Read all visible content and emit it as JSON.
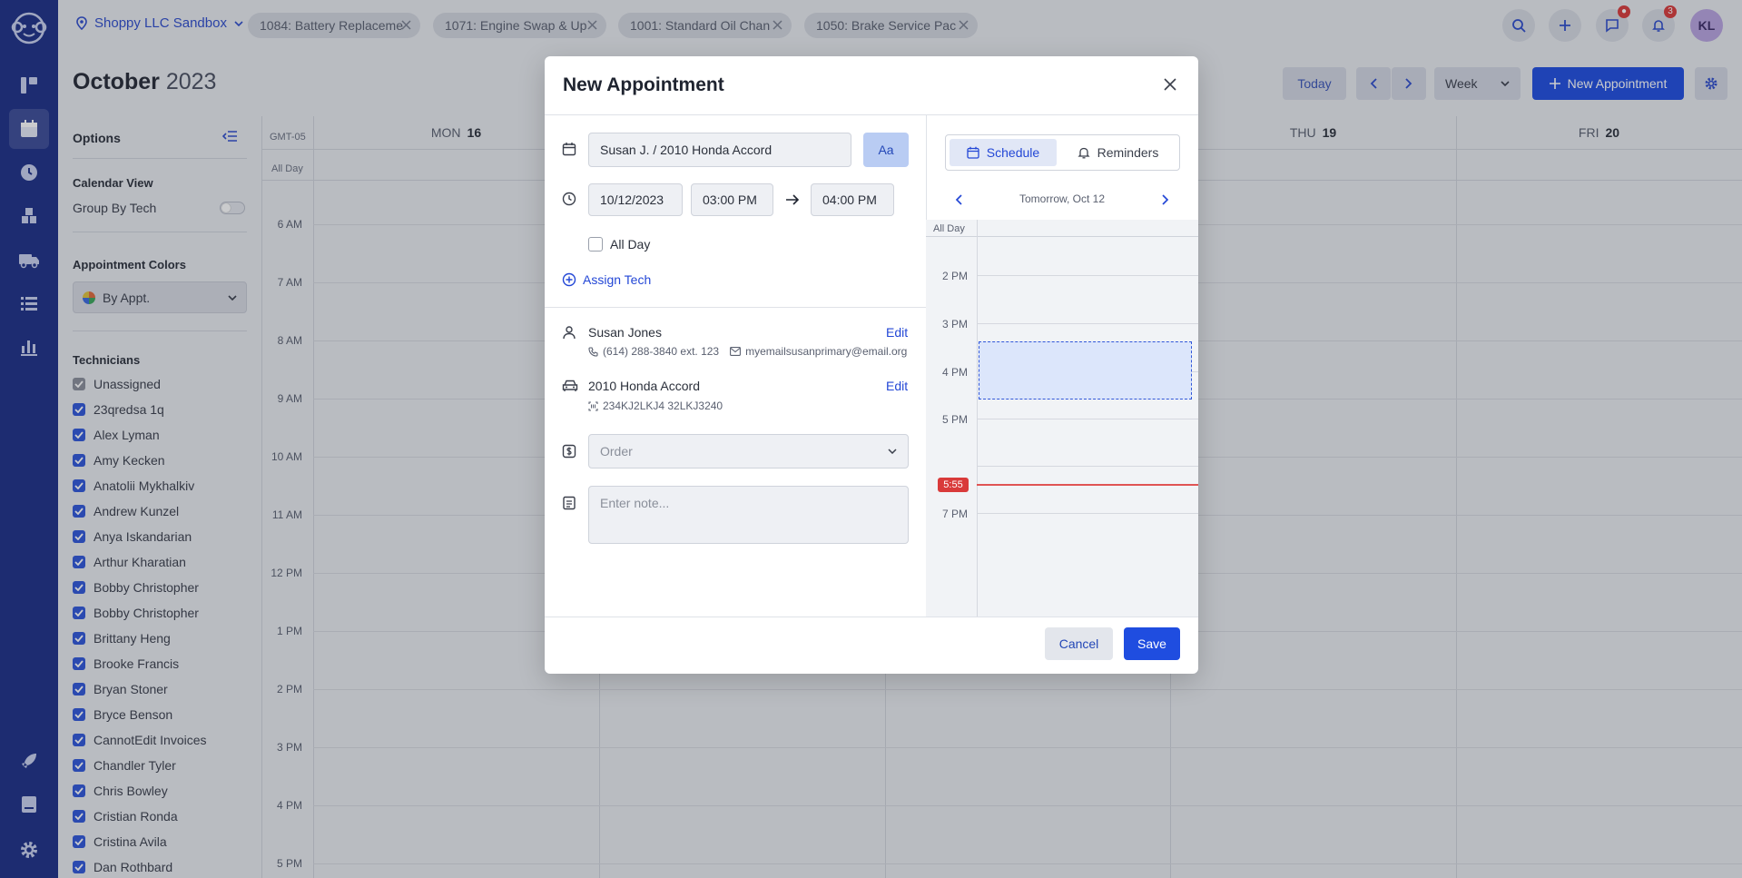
{
  "topbar": {
    "org": "Shoppy LLC Sandbox",
    "tabs": [
      "1084: Battery Replaceme",
      "1071: Engine Swap & Up",
      "1001: Standard Oil Chan",
      "1050: Brake Service Pac"
    ],
    "notif_count": "3",
    "avatar": "KL"
  },
  "calendar": {
    "month": "October",
    "year": "2023",
    "today_label": "Today",
    "view": "Week",
    "new_label": "New Appointment",
    "timezone": "GMT-05",
    "all_day": "All Day",
    "columns": [
      {
        "dow": "MON",
        "day": "16"
      },
      {
        "dow": "THU",
        "day": "19"
      },
      {
        "dow": "FRI",
        "day": "20"
      }
    ],
    "hours": [
      "6 AM",
      "7 AM",
      "8 AM",
      "9 AM",
      "10 AM",
      "11 AM",
      "12 PM",
      "1 PM",
      "2 PM",
      "3 PM",
      "4 PM",
      "5 PM"
    ]
  },
  "options": {
    "title": "Options",
    "calendar_view": "Calendar View",
    "group_by_tech": "Group By Tech",
    "appt_colors": "Appointment Colors",
    "color_mode": "By Appt.",
    "technicians_title": "Technicians",
    "technicians": [
      "Unassigned",
      "23qredsa 1q",
      "Alex Lyman",
      "Amy Kecken",
      "Anatolii Mykhalkiv",
      "Andrew Kunzel",
      "Anya Iskandarian",
      "Arthur Kharatian",
      "Bobby Christopher",
      "Bobby Christopher",
      "Brittany Heng",
      "Brooke Francis",
      "Bryan Stoner",
      "Bryce Benson",
      "CannotEdit Invoices",
      "Chandler Tyler",
      "Chris Bowley",
      "Cristian Ronda",
      "Cristina Avila",
      "Dan Rothbard"
    ]
  },
  "modal": {
    "title": "New Appointment",
    "appt_title": "Susan J. / 2010 Honda Accord",
    "aa": "Aa",
    "date": "10/12/2023",
    "start": "03:00 PM",
    "end": "04:00 PM",
    "all_day": "All Day",
    "assign_tech": "Assign Tech",
    "customer": {
      "name": "Susan Jones",
      "phone": "(614) 288-3840 ext. 123",
      "email": "myemailsusanprimary@email.org",
      "edit": "Edit"
    },
    "vehicle": {
      "name": "2010 Honda Accord",
      "vin": "234KJ2LKJ4 32LKJ3240",
      "edit": "Edit"
    },
    "order_placeholder": "Order",
    "note_placeholder": "Enter note...",
    "tabs": {
      "schedule": "Schedule",
      "reminders": "Reminders"
    },
    "day_label": "Tomorrow, Oct 12",
    "mini_all_day": "All Day",
    "mini_hours": [
      "2 PM",
      "3 PM",
      "4 PM",
      "5 PM",
      "7 PM"
    ],
    "now": "5:55",
    "cancel": "Cancel",
    "save": "Save"
  }
}
